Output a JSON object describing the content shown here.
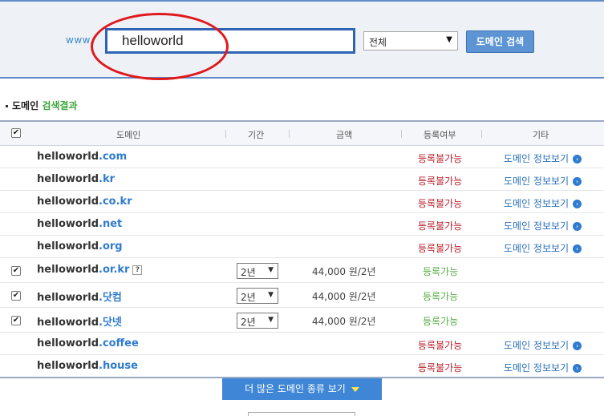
{
  "search": {
    "prefix": "www.",
    "value": "helloworld",
    "type_selected": "전체",
    "button_label": "도메인 검색"
  },
  "results": {
    "title_prefix": "도메인",
    "title_highlight": "검색결과",
    "columns": [
      "도메인",
      "기간",
      "금액",
      "등록여부",
      "기타"
    ],
    "rows": [
      {
        "name": "helloworld",
        "tld": ".com",
        "checked": false,
        "status": "등록불가능",
        "link": "도메인 정보보기"
      },
      {
        "name": "helloworld",
        "tld": ".kr",
        "checked": false,
        "status": "등록불가능",
        "link": "도메인 정보보기"
      },
      {
        "name": "helloworld",
        "tld": ".co.kr",
        "checked": false,
        "status": "등록불가능",
        "link": "도메인 정보보기"
      },
      {
        "name": "helloworld",
        "tld": ".net",
        "checked": false,
        "status": "등록불가능",
        "link": "도메인 정보보기"
      },
      {
        "name": "helloworld",
        "tld": ".org",
        "checked": false,
        "status": "등록불가능",
        "link": "도메인 정보보기"
      },
      {
        "name": "helloworld",
        "tld": ".or.kr",
        "checked": true,
        "help": "?",
        "period": "2년",
        "price": "44,000 원/2년",
        "status": "등록가능"
      },
      {
        "name": "helloworld",
        "tld": ".닷컴",
        "checked": true,
        "period": "2년",
        "price": "44,000 원/2년",
        "status": "등록가능"
      },
      {
        "name": "helloworld",
        "tld": ".닷넷",
        "checked": true,
        "period": "2년",
        "price": "44,000 원/2년",
        "status": "등록가능"
      },
      {
        "name": "helloworld",
        "tld": ".coffee",
        "checked": false,
        "status": "등록불가능",
        "link": "도메인 정보보기"
      },
      {
        "name": "helloworld",
        "tld": ".house",
        "checked": false,
        "status": "등록불가능",
        "link": "도메인 정보보기"
      }
    ],
    "more_label": "더 많은 도메인 종류 보기"
  },
  "colors": {
    "accent": "#5d94d3",
    "unavailable": "#b8232e",
    "available": "#5aac48",
    "highlight_ring": "#e0191d"
  }
}
